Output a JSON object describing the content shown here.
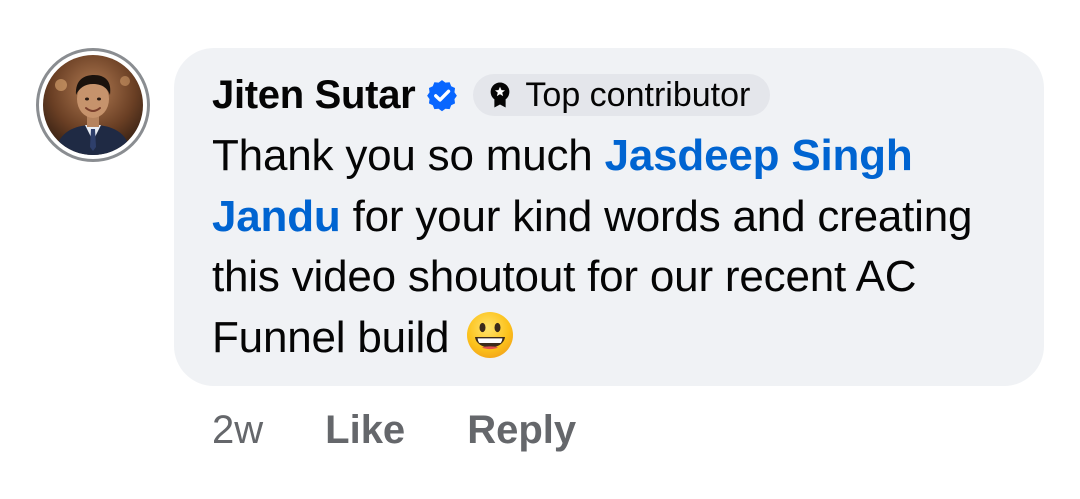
{
  "comment": {
    "author": {
      "name": "Jiten Sutar",
      "verified": true,
      "badge_label": "Top contributor",
      "avatar_icon": "profile-photo"
    },
    "body": {
      "text_before_mention": "Thank you so much ",
      "mention": "Jasdeep Singh Jandu",
      "text_after_mention": " for your kind words and creating this video shoutout for our recent AC Funnel build",
      "emoji": "grinning-face-emoji"
    },
    "footer": {
      "timestamp": "2w",
      "like_label": "Like",
      "reply_label": "Reply"
    }
  },
  "colors": {
    "bubble_background": "#f0f2f5",
    "mention": "#0064d1",
    "verified_badge": "#0866ff",
    "badge_background": "#e4e6eb",
    "secondary_text": "#65676b"
  }
}
